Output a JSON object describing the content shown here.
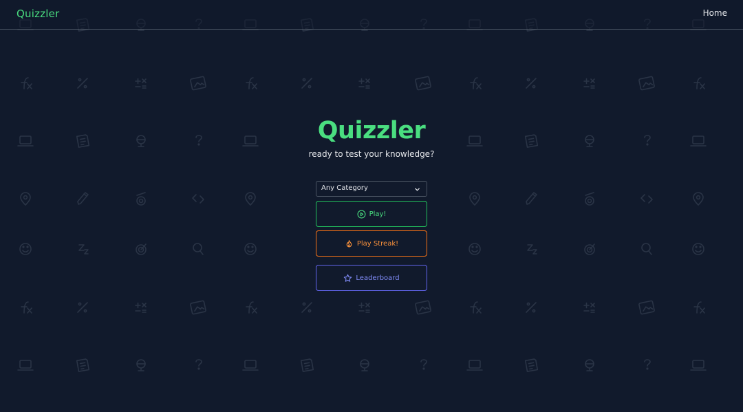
{
  "navbar": {
    "brand": "Quizzler",
    "home_link": "Home"
  },
  "hero": {
    "title": "Quizzler",
    "subtitle": "ready to test your knowledge?"
  },
  "category_select": {
    "selected": "Any Category",
    "icon": "chevron-down-icon"
  },
  "actions": {
    "play": {
      "label": "Play!",
      "icon": "play-circle-icon",
      "color": "#4ade80"
    },
    "streak": {
      "label": "Play Streak!",
      "icon": "flame-icon",
      "color": "#fb923c"
    },
    "leaderboard": {
      "label": "Leaderboard",
      "icon": "star-icon",
      "color": "#818cf8"
    }
  },
  "background": {
    "color": "#111a2c",
    "pattern_icons": [
      "function-icon",
      "divide-icon",
      "calculator-icon",
      "picture-icon",
      "laptop-icon",
      "note-icon",
      "globe-icon",
      "question-icon",
      "location-pin-icon",
      "pencil-icon",
      "telescope-icon",
      "code-icon",
      "smile-icon",
      "music-icon",
      "target-icon",
      "search-icon"
    ]
  }
}
